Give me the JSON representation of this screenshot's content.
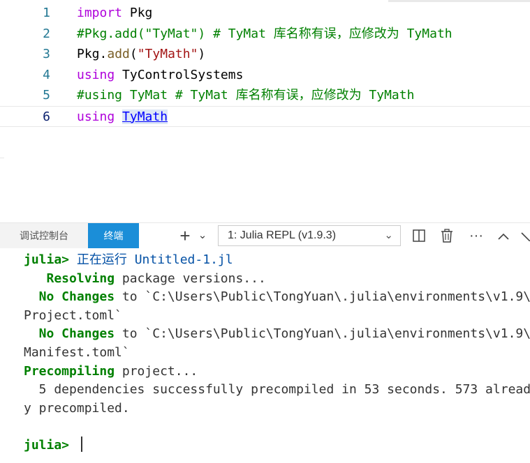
{
  "editor": {
    "lines": [
      {
        "num": "1",
        "parts": [
          [
            "kw",
            "import"
          ],
          [
            "plain",
            " Pkg"
          ]
        ]
      },
      {
        "num": "2",
        "parts": [
          [
            "cmt",
            "#Pkg.add(\"TyMat\") # TyMat 库名称有误，应修改为 TyMath"
          ]
        ]
      },
      {
        "num": "3",
        "parts": [
          [
            "plain",
            "Pkg."
          ],
          [
            "fn",
            "add"
          ],
          [
            "plain",
            "("
          ],
          [
            "str",
            "\"TyMath\""
          ],
          [
            "plain",
            ")"
          ]
        ]
      },
      {
        "num": "4",
        "parts": [
          [
            "kw",
            "using"
          ],
          [
            "plain",
            " TyControlSystems"
          ]
        ]
      },
      {
        "num": "5",
        "parts": [
          [
            "cmt",
            "#using TyMat # TyMat 库名称有误，应修改为 TyMath"
          ]
        ]
      },
      {
        "num": "6",
        "parts": [
          [
            "kw",
            "using"
          ],
          [
            "plain",
            " "
          ],
          [
            "link",
            "TyMath"
          ]
        ]
      }
    ]
  },
  "panel": {
    "tabs": {
      "debug": "调试控制台",
      "terminal": "终端"
    },
    "terminal_select": "1: Julia REPL (v1.9.3)",
    "icons": [
      "add-icon",
      "chevron-down-icon",
      "split-icon",
      "trash-icon",
      "more-icon",
      "chevron-up-icon",
      "close-icon"
    ]
  },
  "terminal": {
    "lines": [
      [
        [
          "g",
          "julia> "
        ],
        [
          "b",
          "正在运行 Untitled-1.jl"
        ]
      ],
      [
        [
          "g",
          "   Resolving"
        ],
        [
          "plain",
          " package versions..."
        ]
      ],
      [
        [
          "g",
          "  No Changes"
        ],
        [
          "plain",
          " to `C:\\Users\\Public\\TongYuan\\.julia\\environments\\v1.9\\"
        ]
      ],
      [
        [
          "plain",
          "Project.toml`"
        ]
      ],
      [
        [
          "g",
          "  No Changes"
        ],
        [
          "plain",
          " to `C:\\Users\\Public\\TongYuan\\.julia\\environments\\v1.9\\"
        ]
      ],
      [
        [
          "plain",
          "Manifest.toml`"
        ]
      ],
      [
        [
          "g",
          "Precompiling"
        ],
        [
          "plain",
          " project..."
        ]
      ],
      [
        [
          "plain",
          "  5 dependencies successfully precompiled in 53 seconds. 573 alread"
        ]
      ],
      [
        [
          "plain",
          "y precompiled."
        ]
      ],
      [
        [
          "plain",
          ""
        ]
      ],
      [
        [
          "g",
          "julia> "
        ]
      ]
    ]
  }
}
